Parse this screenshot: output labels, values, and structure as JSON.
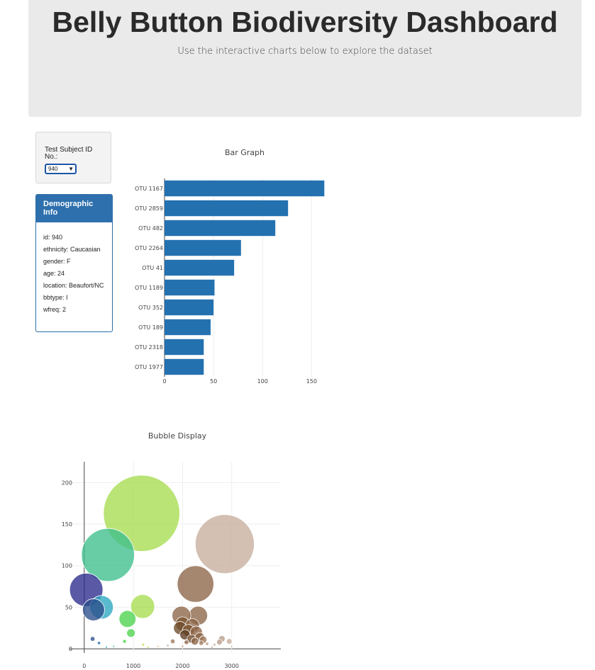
{
  "header": {
    "title": "Belly Button Biodiversity Dashboard",
    "subtitle": "Use the interactive charts below to explore the dataset"
  },
  "selector": {
    "label": "Test Subject ID No.:",
    "selected": "940"
  },
  "demographics": {
    "heading": "Demographic Info",
    "rows": [
      "id: 940",
      "ethnicity: Caucasian",
      "gender: F",
      "age: 24",
      "location: Beaufort/NC",
      "bbtype: I",
      "wfreq: 2"
    ]
  },
  "colors": {
    "bar": "#2471b0",
    "panel_header": "#2d70ad",
    "jumbotron": "#eaeaea"
  },
  "chart_data": [
    {
      "type": "bar",
      "orientation": "horizontal",
      "title": "Bar Graph",
      "categories": [
        "OTU 1167",
        "OTU 2859",
        "OTU 482",
        "OTU 2264",
        "OTU 41",
        "OTU 1189",
        "OTU 352",
        "OTU 189",
        "OTU 2318",
        "OTU 1977"
      ],
      "values": [
        163,
        126,
        113,
        78,
        71,
        51,
        50,
        47,
        40,
        40
      ],
      "xlim": [
        0,
        170
      ],
      "xticks": [
        0,
        50,
        100,
        150
      ],
      "grid": true
    },
    {
      "type": "scatter",
      "subtype": "bubble",
      "title": "Bubble Display",
      "xlim": [
        -300,
        4000
      ],
      "ylim": [
        -5,
        225
      ],
      "xticks": [
        0,
        1000,
        2000,
        3000
      ],
      "yticks": [
        0,
        50,
        100,
        150,
        200
      ],
      "grid": true,
      "points": [
        {
          "x": 1167,
          "y": 163,
          "size": 163,
          "color": "#a6dc50"
        },
        {
          "x": 2859,
          "y": 126,
          "size": 126,
          "color": "#c6ae9e"
        },
        {
          "x": 482,
          "y": 113,
          "size": 113,
          "color": "#3dbf8c"
        },
        {
          "x": 2264,
          "y": 78,
          "size": 78,
          "color": "#8c6446"
        },
        {
          "x": 41,
          "y": 71,
          "size": 71,
          "color": "#2b2a8c"
        },
        {
          "x": 1189,
          "y": 51,
          "size": 51,
          "color": "#a6dc50"
        },
        {
          "x": 352,
          "y": 50,
          "size": 50,
          "color": "#2aa6c0"
        },
        {
          "x": 189,
          "y": 47,
          "size": 47,
          "color": "#2a4e8c"
        },
        {
          "x": 2318,
          "y": 40,
          "size": 40,
          "color": "#8c6446"
        },
        {
          "x": 1977,
          "y": 40,
          "size": 40,
          "color": "#8c6446"
        },
        {
          "x": 880,
          "y": 36,
          "size": 36,
          "color": "#4cd24c"
        },
        {
          "x": 2000,
          "y": 30,
          "size": 30,
          "color": "#7a5430"
        },
        {
          "x": 2200,
          "y": 28,
          "size": 30,
          "color": "#8c6446"
        },
        {
          "x": 1950,
          "y": 25,
          "size": 28,
          "color": "#6e4a2a"
        },
        {
          "x": 2120,
          "y": 22,
          "size": 26,
          "color": "#7a5430"
        },
        {
          "x": 2280,
          "y": 20,
          "size": 26,
          "color": "#8c6446"
        },
        {
          "x": 2050,
          "y": 17,
          "size": 22,
          "color": "#5e3c22"
        },
        {
          "x": 2350,
          "y": 14,
          "size": 20,
          "color": "#8c6446"
        },
        {
          "x": 950,
          "y": 19,
          "size": 18,
          "color": "#4cd24c"
        },
        {
          "x": 2180,
          "y": 12,
          "size": 18,
          "color": "#6e4a2a"
        },
        {
          "x": 2420,
          "y": 11,
          "size": 16,
          "color": "#a07a5a"
        },
        {
          "x": 2250,
          "y": 9,
          "size": 16,
          "color": "#8c6446"
        },
        {
          "x": 2800,
          "y": 12,
          "size": 14,
          "color": "#b89e8a"
        },
        {
          "x": 2950,
          "y": 9,
          "size": 12,
          "color": "#c6ae9e"
        },
        {
          "x": 2750,
          "y": 8,
          "size": 12,
          "color": "#b89e8a"
        },
        {
          "x": 1800,
          "y": 9,
          "size": 10,
          "color": "#a07a5a"
        },
        {
          "x": 2080,
          "y": 8,
          "size": 10,
          "color": "#8c6446"
        },
        {
          "x": 2380,
          "y": 7,
          "size": 10,
          "color": "#a07a5a"
        },
        {
          "x": 170,
          "y": 12,
          "size": 10,
          "color": "#2a4e8c"
        },
        {
          "x": 820,
          "y": 9,
          "size": 8,
          "color": "#4cd24c"
        },
        {
          "x": 300,
          "y": 7,
          "size": 7,
          "color": "#2a70a8"
        },
        {
          "x": 1200,
          "y": 5,
          "size": 6,
          "color": "#c6dc50"
        },
        {
          "x": 2500,
          "y": 6,
          "size": 7,
          "color": "#b89e8a"
        },
        {
          "x": 2650,
          "y": 5,
          "size": 6,
          "color": "#c6ae9e"
        },
        {
          "x": 1700,
          "y": 4,
          "size": 5,
          "color": "#b89e8a"
        },
        {
          "x": 600,
          "y": 3,
          "size": 4,
          "color": "#3dbf8c"
        },
        {
          "x": 1500,
          "y": 3,
          "size": 4,
          "color": "#e0c060"
        },
        {
          "x": 2000,
          "y": 3,
          "size": 4,
          "color": "#a07a5a"
        },
        {
          "x": 3000,
          "y": 3,
          "size": 4,
          "color": "#c6ae9e"
        },
        {
          "x": 2600,
          "y": 2,
          "size": 3,
          "color": "#b89e8a"
        },
        {
          "x": 450,
          "y": 2,
          "size": 3,
          "color": "#2aa6c0"
        },
        {
          "x": 1300,
          "y": 2,
          "size": 3,
          "color": "#a6dc50"
        }
      ]
    }
  ]
}
